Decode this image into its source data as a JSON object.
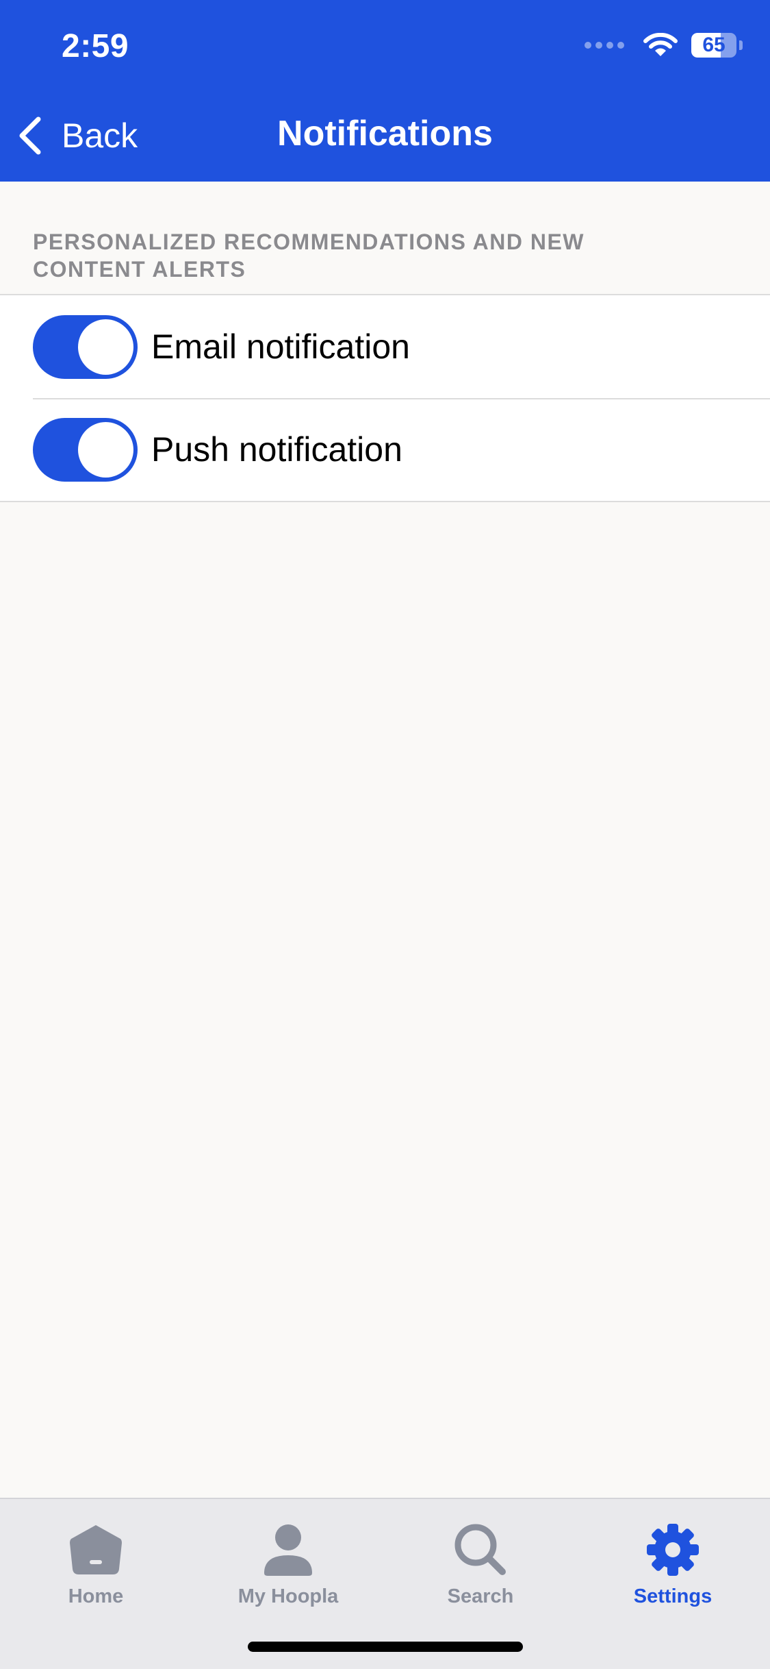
{
  "status_bar": {
    "time": "2:59",
    "battery_level": "65",
    "battery_fraction": 0.65
  },
  "nav": {
    "back_label": "Back",
    "title": "Notifications"
  },
  "section": {
    "header": "PERSONALIZED RECOMMENDATIONS AND NEW CONTENT ALERTS",
    "items": [
      {
        "label": "Email notification",
        "enabled": true
      },
      {
        "label": "Push notification",
        "enabled": true
      }
    ]
  },
  "tab_bar": {
    "tabs": [
      {
        "label": "Home",
        "icon": "home-icon",
        "active": false
      },
      {
        "label": "My Hoopla",
        "icon": "person-icon",
        "active": false
      },
      {
        "label": "Search",
        "icon": "search-icon",
        "active": false
      },
      {
        "label": "Settings",
        "icon": "gear-icon",
        "active": true
      }
    ]
  },
  "colors": {
    "accent": "#1f52de",
    "header_bg": "#1f52de",
    "page_bg": "#faf9f7",
    "tab_bar_bg": "#e9e9ec",
    "tab_inactive": "#8a8f9c",
    "section_header_text": "#8a8a8e"
  }
}
